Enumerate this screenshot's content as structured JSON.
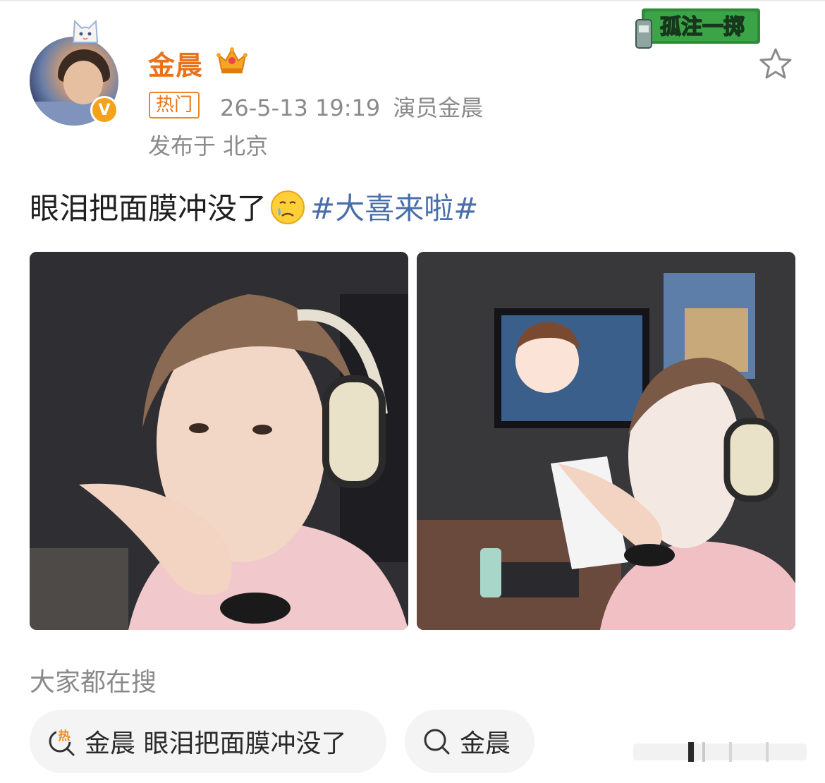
{
  "post": {
    "author": "金晨",
    "hot_tag": "热门",
    "time": "26-5-13 19:19",
    "source": "演员金晨",
    "location": "发布于 北京",
    "text": "眼泪把面膜冲没了",
    "hashtag": "#大喜来啦#",
    "verified_badge": "V"
  },
  "logo": {
    "text": "孤注一掷"
  },
  "search": {
    "title": "大家都在搜",
    "chips": [
      {
        "label": "金晨 眼泪把面膜冲没了",
        "icon": "hot-search-icon"
      },
      {
        "label": "金晨",
        "icon": "search-icon"
      }
    ]
  },
  "colors": {
    "author": "#e8731b",
    "hashtag": "#4a6ea9",
    "meta": "#8a8a8a",
    "verified": "#f4a21b"
  }
}
